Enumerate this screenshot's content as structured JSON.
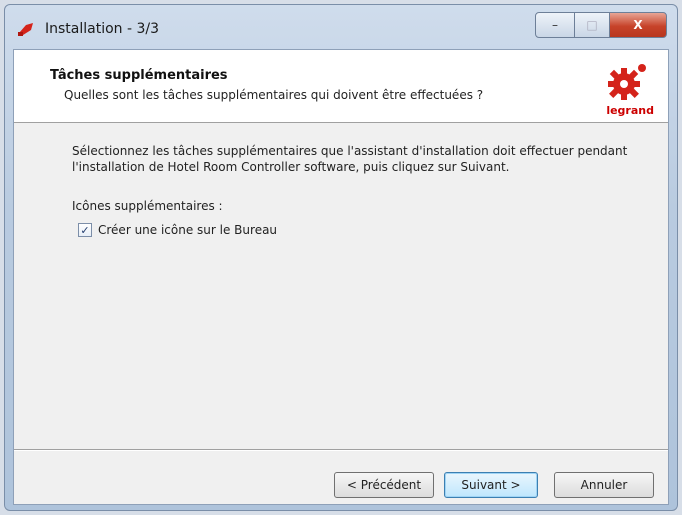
{
  "window": {
    "title": "Installation - 3/3",
    "controls": {
      "minimize": "–",
      "maximize": "□",
      "close": "X"
    }
  },
  "header": {
    "title": "Tâches supplémentaires",
    "subtitle": "Quelles sont les tâches supplémentaires qui doivent être effectuées ?",
    "logo_text": "legrand"
  },
  "body": {
    "description": "Sélectionnez les tâches supplémentaires que l'assistant d'installation doit effectuer pendant l'installation de Hotel Room Controller software, puis cliquez sur Suivant.",
    "icons_label": "Icônes supplémentaires :",
    "checkbox": {
      "label": "Créer une icône sur le Bureau",
      "checked": true,
      "mark": "✓"
    }
  },
  "buttons": {
    "back": "< Précédent",
    "next": "Suivant >",
    "cancel": "Annuler"
  },
  "colors": {
    "brand_red": "#cc0000",
    "accent": "#3c7fb1"
  }
}
